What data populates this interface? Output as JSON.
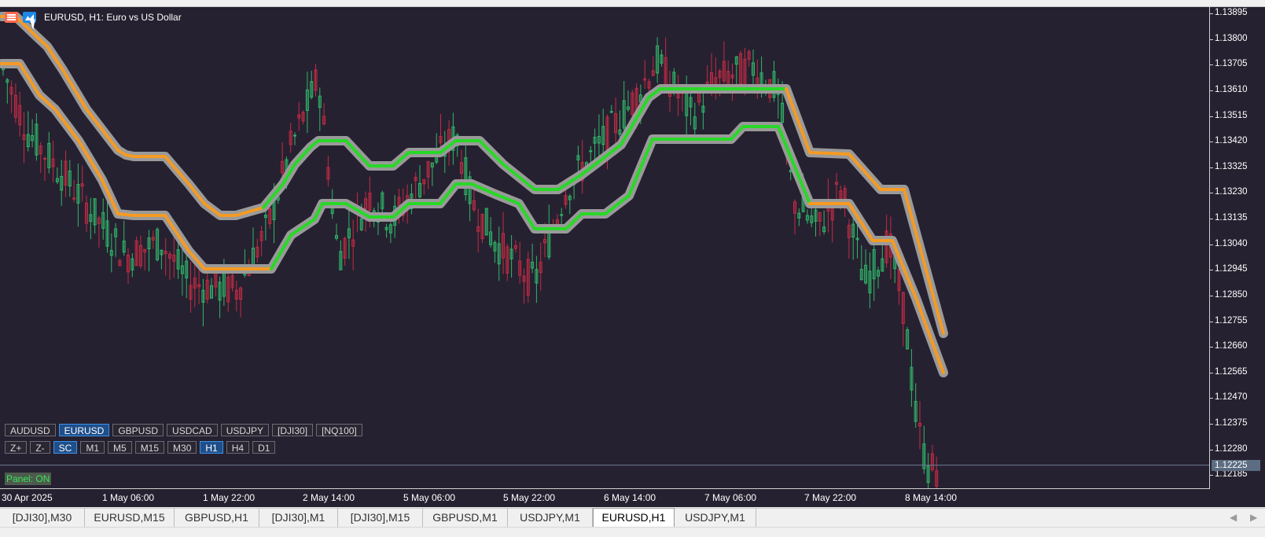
{
  "chart": {
    "title": "EURUSD, H1:  Euro vs US Dollar",
    "current_price": "1.12225",
    "colors": {
      "background": "#262130",
      "bull": "#2fb86a",
      "bear": "#c42b45",
      "channel_outline": "#9a9a9a",
      "channel_down": "#f59a23",
      "channel_up": "#28d827"
    },
    "price_axis": [
      "1.13895",
      "1.13800",
      "1.13705",
      "1.13610",
      "1.13515",
      "1.13420",
      "1.13325",
      "1.13230",
      "1.13135",
      "1.13040",
      "1.12945",
      "1.12850",
      "1.12755",
      "1.12660",
      "1.12565",
      "1.12470",
      "1.12375",
      "1.12280",
      "1.12185"
    ],
    "time_axis": [
      "30 Apr 2025",
      "1 May 06:00",
      "1 May 22:00",
      "2 May 14:00",
      "5 May 06:00",
      "5 May 22:00",
      "6 May 14:00",
      "7 May 06:00",
      "7 May 22:00",
      "8 May 14:00"
    ]
  },
  "panel": {
    "symbols": [
      "AUDUSD",
      "EURUSD",
      "GBPUSD",
      "USDCAD",
      "USDJPY",
      "[DJI30]",
      "[NQ100]"
    ],
    "active_symbol": "EURUSD",
    "timeframes": [
      "Z+",
      "Z-",
      "SC",
      "M1",
      "M5",
      "M15",
      "M30",
      "H1",
      "H4",
      "D1"
    ],
    "active_timeframes": [
      "SC",
      "H1"
    ],
    "status": "Panel: ON"
  },
  "tabs": [
    "[DJI30],M30",
    "EURUSD,M15",
    "GBPUSD,H1",
    "[DJI30],M1",
    "[DJI30],M15",
    "GBPUSD,M1",
    "USDJPY,M1",
    "EURUSD,H1",
    "USDJPY,M1"
  ],
  "active_tab": "EURUSD,H1",
  "icons": [
    "menu-icon",
    "chart-icon",
    "mouse-cursor-icon",
    "scroll-left-icon",
    "scroll-right-icon"
  ]
}
